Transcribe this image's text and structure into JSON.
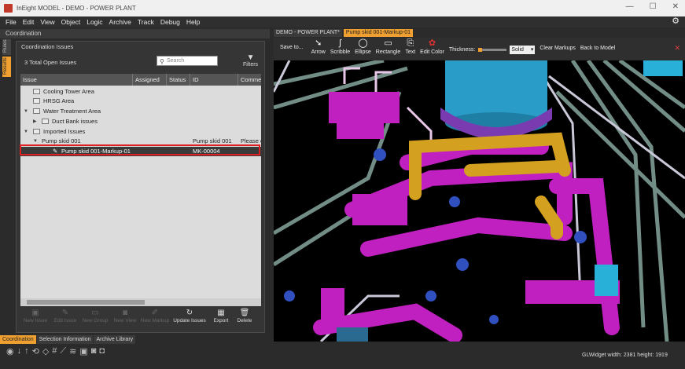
{
  "window": {
    "title": "InEight MODEL - DEMO - POWER PLANT"
  },
  "menu": [
    "File",
    "Edit",
    "View",
    "Object",
    "Logic",
    "Archive",
    "Track",
    "Debug",
    "Help"
  ],
  "left_panel": {
    "header": "Coordination",
    "side_tabs": {
      "rules": "Rules",
      "results": "Results"
    },
    "box_title": "Coordination Issues",
    "open_issues": "3  Total Open Issues",
    "search_placeholder": "Search",
    "filters_label": "Filters",
    "columns": [
      "Issue",
      "Assigned",
      "Status",
      "ID",
      "Comme"
    ],
    "rows": [
      {
        "label": "Cooling Tower Area",
        "id": "",
        "comment": ""
      },
      {
        "label": "HRSG Area",
        "id": "",
        "comment": ""
      },
      {
        "label": "Water Treatment Area",
        "id": "",
        "comment": ""
      },
      {
        "label": "Duct Bank issues",
        "id": "",
        "comment": ""
      },
      {
        "label": "Imported Issues",
        "id": "",
        "comment": ""
      },
      {
        "label": "Pump skid 001",
        "id": "Pump skid 001",
        "comment": "Please c"
      },
      {
        "label": "Pump skid 001-Markup-01",
        "id": "MK-00004",
        "comment": ""
      }
    ],
    "toolbar": [
      "New Issue",
      "Edit Issue",
      "New Group",
      "New View",
      "New Markup",
      "Update Issues",
      "Export",
      "Delete"
    ],
    "bottom_tabs": [
      "Coordination",
      "Selection Information",
      "Archive Library"
    ]
  },
  "doc_tabs": [
    "DEMO - POWER PLANT*",
    "Pump skid 001-Markup-01"
  ],
  "markup_toolbar": {
    "save": "Save to...",
    "tools": [
      "Arrow",
      "Scribble",
      "Ellipse",
      "Rectangle",
      "Text"
    ],
    "edit_color": "Edit Color",
    "thickness_label": "Thickness:",
    "thickness_level": 0.15,
    "line_style": "Solid",
    "clear": "Clear Markups",
    "back": "Back to Model"
  },
  "status": "GLWidget  width: 2381       height: 1919",
  "colors": {
    "accent": "#f0a030",
    "selection_outline": "#e02020",
    "pipe_magenta": "#c020c0",
    "pipe_yellow": "#d4a020",
    "tank_blue": "#2a9cc8"
  }
}
